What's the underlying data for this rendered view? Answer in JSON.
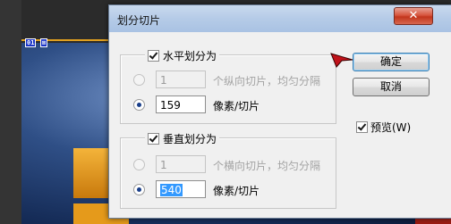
{
  "dialog": {
    "title": "划分切片",
    "close_symbol": "✕"
  },
  "slice_tag": {
    "left": "01",
    "right": "⊠"
  },
  "horizontal": {
    "checkbox_label": "水平划分为",
    "checked": true,
    "option_count": {
      "value": "1",
      "label": "个纵向切片，均匀分隔",
      "selected": false,
      "enabled": false
    },
    "option_pixels": {
      "value": "159",
      "label": "像素/切片",
      "selected": true
    }
  },
  "vertical": {
    "checkbox_label": "垂直划分为",
    "checked": true,
    "option_count": {
      "value": "1",
      "label": "个横向切片，均匀分隔",
      "selected": false,
      "enabled": false
    },
    "option_pixels": {
      "value": "540",
      "label": "像素/切片",
      "selected": true
    }
  },
  "buttons": {
    "ok": "确定",
    "cancel": "取消"
  },
  "preview": {
    "label": "预览(W)",
    "checked": true
  }
}
